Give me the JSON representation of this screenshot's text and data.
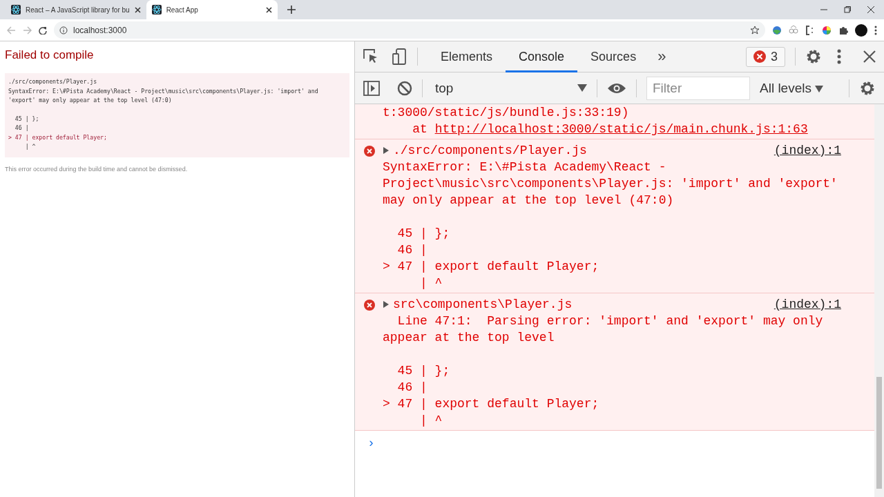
{
  "browser": {
    "tabs": [
      {
        "title": "React – A JavaScript library for bu",
        "selected": false
      },
      {
        "title": "React App",
        "selected": true
      }
    ],
    "address": "localhost:3000"
  },
  "page": {
    "title": "Failed to compile",
    "error": {
      "file": "./src/components/Player.js",
      "message": "SyntaxError: E:\\#Pista Academy\\React - Project\\music\\src\\components\\Player.js: 'import' and 'export' may only appear at the top level (47:0)",
      "code": [
        {
          "text": "  45 | };",
          "highlighted": false
        },
        {
          "text": "  46 |",
          "highlighted": false
        },
        {
          "text": "> 47 | export default Player;",
          "highlighted": true
        },
        {
          "text": "     | ^",
          "highlighted": false
        }
      ]
    },
    "footer": "This error occurred during the build time and cannot be dismissed."
  },
  "devtools": {
    "tabs": [
      {
        "label": "Elements",
        "selected": false
      },
      {
        "label": "Console",
        "selected": true
      },
      {
        "label": "Sources",
        "selected": false
      }
    ],
    "more": "»",
    "error_count": "3",
    "context": "top",
    "filter_placeholder": "Filter",
    "levels": "All levels",
    "continuation": [
      {
        "text": "t:3000/static/js/bundle.js:33:19)",
        "link": false
      },
      {
        "text": "    at ",
        "link": false
      },
      {
        "text": "http://localhost:3000/static/js/main.chunk.js:1:63",
        "link": true
      }
    ],
    "messages": [
      {
        "title": "./src/components/Player.js",
        "source": "(index):1",
        "expanded": false,
        "text": "SyntaxError: E:\\#Pista Academy\\React - Project\\music\\src\\components\\Player.js: 'import' and 'export' may only appear at the top level (47:0)",
        "code": [
          "  45 | };",
          "  46 |",
          "> 47 | export default Player;",
          "     | ^"
        ]
      },
      {
        "title": "src\\components\\Player.js",
        "source": "(index):1",
        "expanded": false,
        "text": "  Line 47:1:  Parsing error: 'import' and 'export' may only appear at the top level",
        "code": [
          "  45 | };",
          "  46 |",
          "> 47 | export default Player;",
          "     | ^"
        ]
      }
    ],
    "prompt": "›"
  }
}
